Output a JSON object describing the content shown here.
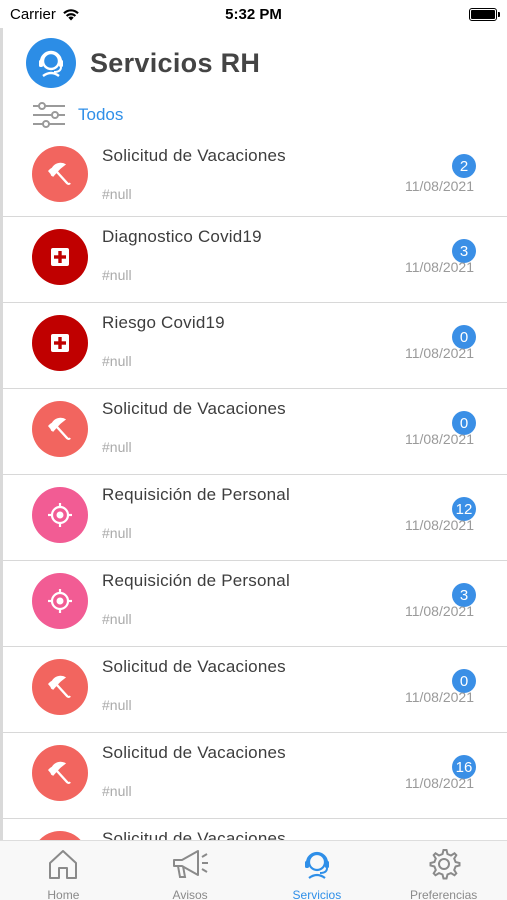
{
  "status_bar": {
    "carrier": "Carrier",
    "time": "5:32 PM"
  },
  "header": {
    "title": "Servicios RH",
    "logo_icon": "support-agent-icon"
  },
  "filter": {
    "label": "Todos",
    "icon": "sliders-icon"
  },
  "colors": {
    "accent": "#2f8fe8",
    "vacaciones": "#f2655f",
    "covid": "#c00000",
    "personal": "#f25c94"
  },
  "items": [
    {
      "title": "Solicitud de Vacaciones",
      "tag": "#null",
      "count": "2",
      "date": "11/08/2021",
      "icon": "umbrella-icon",
      "color": "#f2655f"
    },
    {
      "title": "Diagnostico Covid19",
      "tag": "#null",
      "count": "3",
      "date": "11/08/2021",
      "icon": "medical-cross-icon",
      "color": "#c00000"
    },
    {
      "title": "Riesgo Covid19",
      "tag": "#null",
      "count": "0",
      "date": "11/08/2021",
      "icon": "medical-cross-icon",
      "color": "#c00000"
    },
    {
      "title": "Solicitud de Vacaciones",
      "tag": "#null",
      "count": "0",
      "date": "11/08/2021",
      "icon": "umbrella-icon",
      "color": "#f2655f"
    },
    {
      "title": "Requisición de Personal",
      "tag": "#null",
      "count": "12",
      "date": "11/08/2021",
      "icon": "target-icon",
      "color": "#f25c94"
    },
    {
      "title": "Requisición de Personal",
      "tag": "#null",
      "count": "3",
      "date": "11/08/2021",
      "icon": "target-icon",
      "color": "#f25c94"
    },
    {
      "title": "Solicitud de Vacaciones",
      "tag": "#null",
      "count": "0",
      "date": "11/08/2021",
      "icon": "umbrella-icon",
      "color": "#f2655f"
    },
    {
      "title": "Solicitud de Vacaciones",
      "tag": "#null",
      "count": "16",
      "date": "11/08/2021",
      "icon": "umbrella-icon",
      "color": "#f2655f"
    },
    {
      "title": "Solicitud de Vacaciones",
      "tag": "",
      "count": "",
      "date": "",
      "icon": "umbrella-icon",
      "color": "#f2655f"
    }
  ],
  "tabs": [
    {
      "label": "Home",
      "icon": "home-icon",
      "active": false
    },
    {
      "label": "Avisos",
      "icon": "megaphone-icon",
      "active": false
    },
    {
      "label": "Servicios",
      "icon": "support-agent-icon",
      "active": true
    },
    {
      "label": "Preferencias",
      "icon": "gear-icon",
      "active": false
    }
  ]
}
